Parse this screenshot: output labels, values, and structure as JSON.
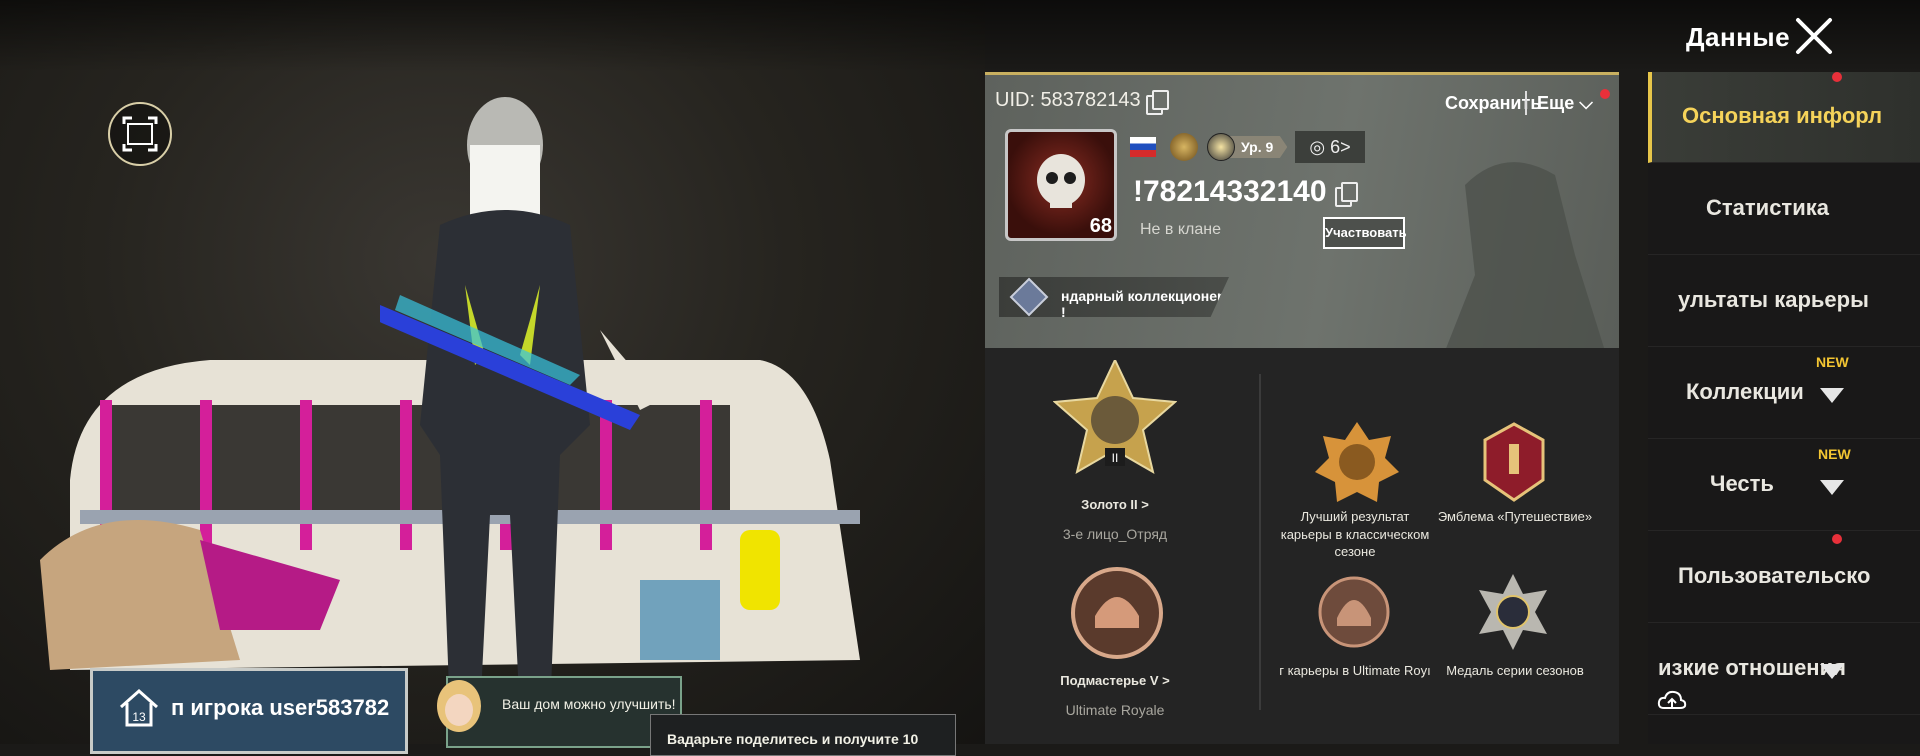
{
  "header": {
    "title": "Данные"
  },
  "profile": {
    "uid": "UID: 583782143",
    "save_label": "Сохранить",
    "more_label": "Еще",
    "avatar_level": "68",
    "level_badge": "Ур. 9",
    "tier": "6>",
    "player_name": "!78214332140",
    "clan_status": "Не в клане",
    "join_label": "Участвовать",
    "title_banner": "ндарный коллекционер !"
  },
  "achievements": {
    "rank1_label": "Золото II  >",
    "rank1_sub": "3-е лицо_Отряд",
    "rank1_roman": "II",
    "best_result": "Лучший результат карьеры в классическом сезоне",
    "emblem_label": "Эмблема «Путешествие»",
    "rank2_label": "Подмастерье V  >",
    "rank2_sub": "Ultimate Royale",
    "career_ur": "г карьеры в Ultimate Royı",
    "season_medal": "Медаль серии сезонов"
  },
  "sidebar": {
    "items": [
      {
        "label": "Основная инфорл"
      },
      {
        "label": "Статистика"
      },
      {
        "label": "ультаты карьеры"
      },
      {
        "label": "Коллекции",
        "tag": "NEW"
      },
      {
        "label": "Честь",
        "tag": "NEW"
      },
      {
        "label": "Пользовательско"
      },
      {
        "label": "изкие отношения"
      }
    ]
  },
  "bottom": {
    "player_card": "п игрока user583782",
    "card_level": "13",
    "chat_msg": "Ваш дом можно улучшить!",
    "share_msg": "Вадарьте поделитесь и получите 10"
  },
  "colors": {
    "accent": "#e7c64a",
    "notify": "#e8303a",
    "new_tag": "#f3c532"
  }
}
